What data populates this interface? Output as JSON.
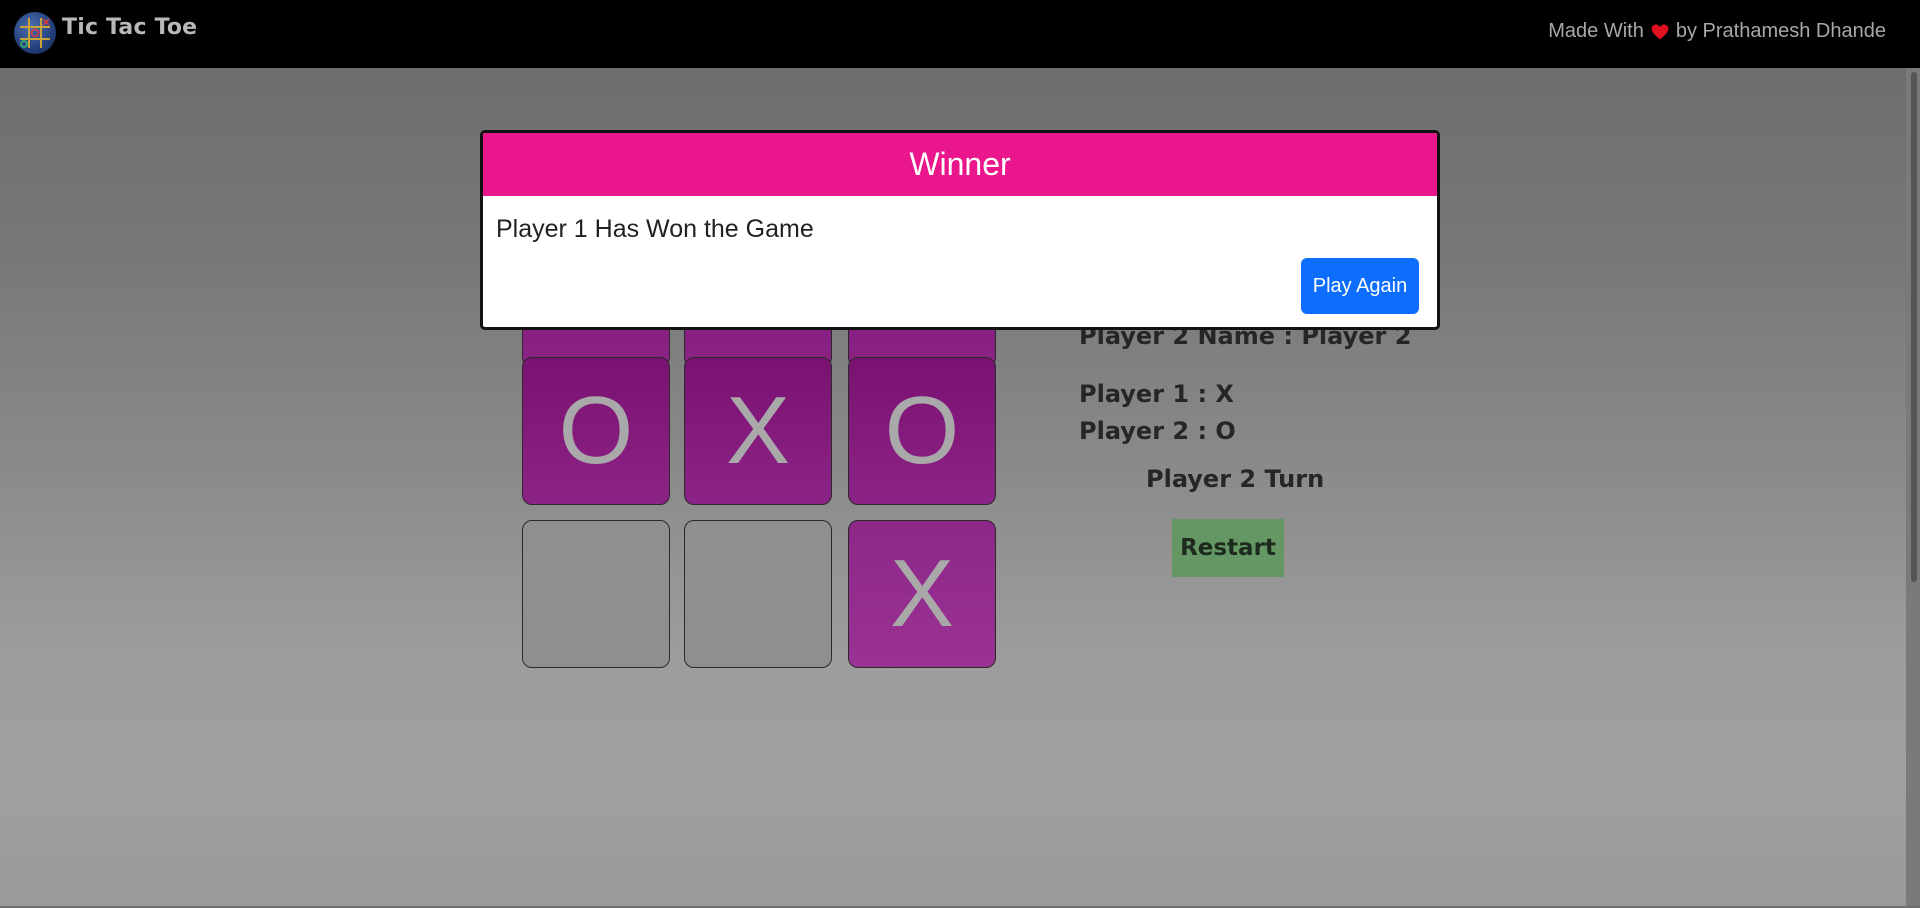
{
  "navbar": {
    "title": "Tic Tac Toe",
    "logo_icon": "tic-tac-toe-logo-icon",
    "credit_prefix": "Made With",
    "credit_icon": "heart-icon",
    "credit_suffix": "by Prathamesh Dhande",
    "heart_color": "#e0111f"
  },
  "board": {
    "rows": [
      [
        "",
        "",
        ""
      ],
      [
        "O",
        "X",
        "O"
      ],
      [
        "",
        "",
        "X"
      ]
    ],
    "filled_color": "#7a1272",
    "empty_color": "#8f8f8f"
  },
  "info": {
    "player2_name_line": "Player 2 Name : Player 2",
    "player1_symbol_line": "Player 1 : X",
    "player2_symbol_line": "Player 2 : O",
    "turn_text": "Player 2 Turn",
    "restart_label": "Restart"
  },
  "modal": {
    "title": "Winner",
    "message": "Player 1 Has Won the Game",
    "play_again_label": "Play Again",
    "header_color": "#ea168b",
    "button_color": "#0d6efd"
  }
}
